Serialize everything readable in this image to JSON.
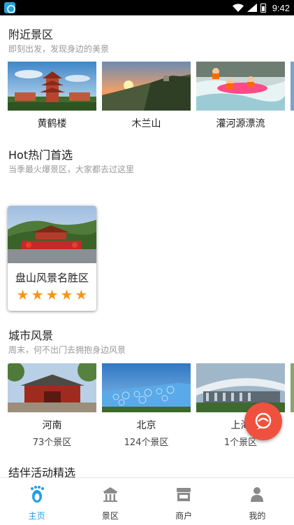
{
  "status_bar": {
    "time": "9:42"
  },
  "sections": {
    "nearby": {
      "title": "附近景区",
      "subtitle": "即刻出发，发现身边的美景",
      "items": [
        {
          "name": "黄鹤楼"
        },
        {
          "name": "木兰山"
        },
        {
          "name": "灌河源漂流"
        }
      ]
    },
    "hot": {
      "title": "Hot热门首选",
      "subtitle": "当季最火爆景区，大家都去过这里",
      "items": [
        {
          "name": "盘山风景名胜区",
          "rating": 5
        }
      ]
    },
    "city": {
      "title": "城市风景",
      "subtitle": "周末，何不出门去拥抱身边风景",
      "items": [
        {
          "name": "河南",
          "count": "73个景区"
        },
        {
          "name": "北京",
          "count": "124个景区"
        },
        {
          "name": "上海",
          "count": "1个景区"
        }
      ]
    },
    "activities": {
      "title": "结伴活动精选"
    }
  },
  "bottom_nav": [
    {
      "label": "主页",
      "icon": "footprint-icon",
      "active": true
    },
    {
      "label": "景区",
      "icon": "temple-icon",
      "active": false
    },
    {
      "label": "商户",
      "icon": "shop-icon",
      "active": false
    },
    {
      "label": "我的",
      "icon": "user-icon",
      "active": false
    }
  ],
  "colors": {
    "accent": "#1e9fe6",
    "star": "#f7941d",
    "fab": "#f0513f"
  }
}
